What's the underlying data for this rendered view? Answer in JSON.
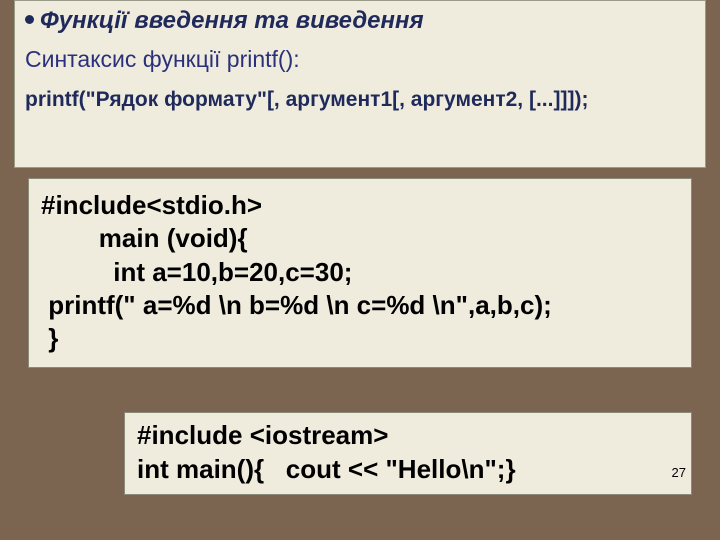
{
  "slide": {
    "heading": "Функції введення та виведення",
    "subtitle": "Синтаксис функції printf():",
    "syntax": "printf(\"Рядок формату\"[, аргумент1[, аргумент2, [...]]]);",
    "code1_l1": "#include<stdio.h>",
    "code1_l2": "        main (void){",
    "code1_l3": "          int a=10,b=20,c=30;",
    "code1_l4": " printf(\" a=%d \\n b=%d \\n c=%d \\n\",a,b,c);",
    "code1_l5": " }",
    "code2_l1": "#include <iostream>",
    "code2_l2": "int main(){   cout << \"Hello\\n\";}",
    "page_number": "27"
  }
}
